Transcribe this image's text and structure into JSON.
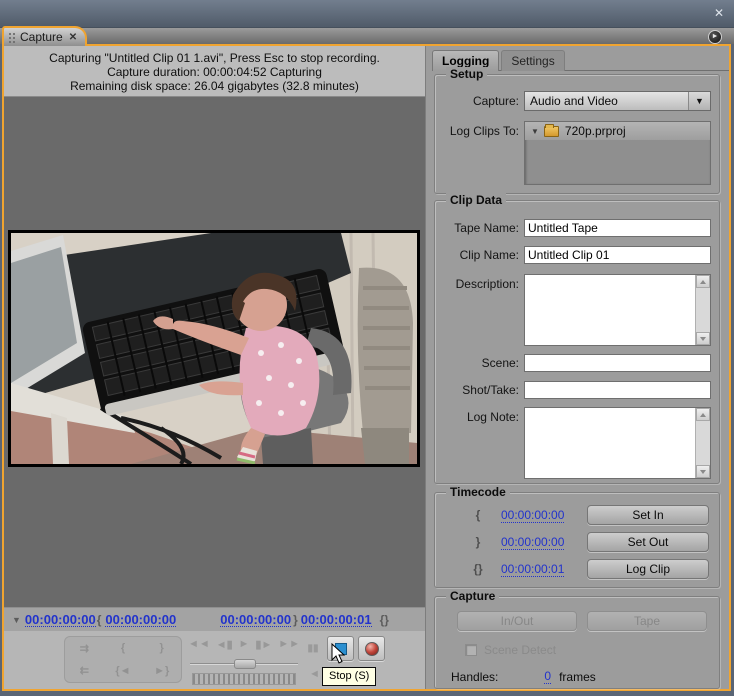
{
  "window": {
    "close_icon": "✕"
  },
  "tab": {
    "label": "Capture",
    "close_icon": "✕"
  },
  "panel_menu_icon": "►",
  "status": {
    "line1": "Capturing \"Untitled Clip 01 1.avi\", Press Esc to stop recording.",
    "line2": "Capture duration: 00:00:04:52 Capturing",
    "line3": "Remaining disk space: 26.04 gigabytes (32.8 minutes)"
  },
  "timecode_bar": {
    "expander_icon": "▼",
    "current": "00:00:00:00",
    "in_icon": "{",
    "in_value": "00:00:00:00",
    "out_value": "00:00:00:00",
    "out_icon": "}",
    "duration_value": "00:00:00:01",
    "duration_icon": "{}"
  },
  "transport": {
    "scene_next_icon": "⇉",
    "set_in_icon": "{",
    "set_out_icon": "}",
    "scene_prev_icon": "⇇",
    "goto_in_icon": "{◄",
    "goto_out_icon": "►}",
    "rewind_icon": "◄◄",
    "step_back_icon": "◄▮",
    "play_icon": "►",
    "step_fwd_icon": "▮►",
    "ffwd_icon": "►►",
    "pause_icon": "▮▮",
    "slow_reverse_icon": "◄",
    "slow_play_icon": "►",
    "stop_tooltip": "Stop (S)"
  },
  "right": {
    "tabs": {
      "logging": "Logging",
      "settings": "Settings"
    },
    "setup": {
      "title": "Setup",
      "capture_label": "Capture:",
      "capture_value": "Audio and Video",
      "dropdown_icon": "▼",
      "log_clips_label": "Log Clips To:",
      "tree_disclosure_icon": "▼",
      "log_clips_value": "720p.prproj"
    },
    "clip_data": {
      "title": "Clip Data",
      "tape_name_label": "Tape Name:",
      "tape_name_value": "Untitled Tape",
      "clip_name_label": "Clip Name:",
      "clip_name_value": "Untitled Clip 01",
      "description_label": "Description:",
      "description_value": "",
      "scene_label": "Scene:",
      "scene_value": "",
      "shot_take_label": "Shot/Take:",
      "shot_take_value": "",
      "log_note_label": "Log Note:",
      "log_note_value": ""
    },
    "timecode": {
      "title": "Timecode",
      "in_icon": "{",
      "in_value": "00:00:00:00",
      "set_in": "Set In",
      "out_icon": "}",
      "out_value": "00:00:00:00",
      "set_out": "Set Out",
      "duration_icon": "{}",
      "duration_value": "00:00:00:01",
      "log_clip": "Log Clip"
    },
    "capture": {
      "title": "Capture",
      "in_out": "In/Out",
      "tape": "Tape",
      "scene_detect": "Scene Detect",
      "handles_label": "Handles:",
      "handles_value": "0",
      "frames_label": "frames"
    }
  },
  "colors": {
    "accent_orange": "#f0a430",
    "link_blue": "#2233cc",
    "stop_blue": "#2b8fd0",
    "record_red": "#c2453a"
  }
}
